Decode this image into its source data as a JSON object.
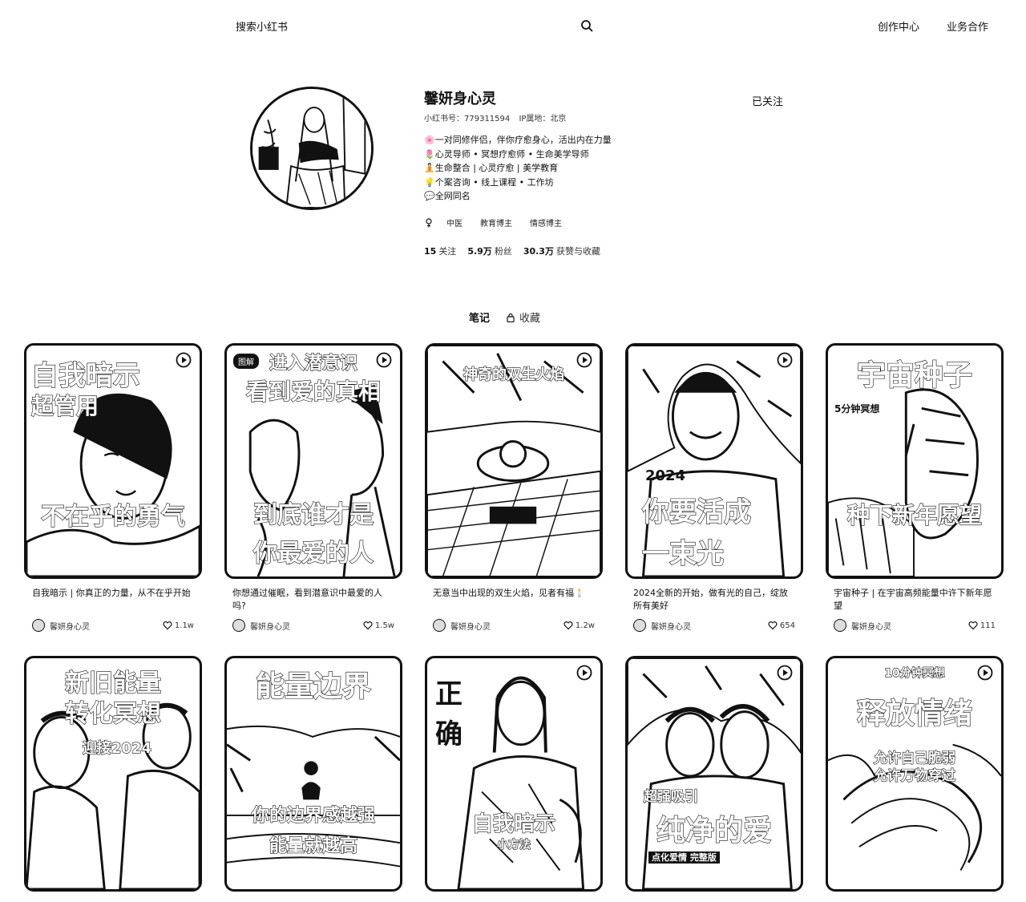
{
  "header": {
    "search_placeholder": "搜索小红书",
    "nav_create": "创作中心",
    "nav_business": "业务合作"
  },
  "profile": {
    "name": "馨妍身心灵",
    "follow_label": "已关注",
    "id_label": "小红书号：779311594",
    "ip_label": "IP属地：北京",
    "bio": [
      "🌸一对同修伴侣，伴你疗愈身心，活出内在力量",
      "🌷心灵导师 • 冥想疗愈师 • 生命美学导师",
      "🧘生命整合 | 心灵疗愈 | 美学教育",
      "💡个案咨询 • 线上课程 • 工作坊",
      "💬全网同名"
    ],
    "tags": [
      "中医",
      "教育博主",
      "情感博主"
    ],
    "stats": [
      {
        "num": "15",
        "label": "关注"
      },
      {
        "num": "5.9万",
        "label": "粉丝"
      },
      {
        "num": "30.3万",
        "label": "获赞与收藏"
      }
    ]
  },
  "tabs": {
    "notes": "笔记",
    "collect": "收藏"
  },
  "notes": [
    {
      "title": "自我暗示 | 你真正的力量，从不在乎开始",
      "author": "馨妍身心灵",
      "likes": "1.1w",
      "overlay": [
        "自我暗示",
        "超管用",
        "不在乎的勇气"
      ]
    },
    {
      "title": "你想通过催眠，看到潜意识中最爱的人吗?",
      "author": "馨妍身心灵",
      "likes": "1.5w",
      "badge": "图解",
      "overlay": [
        "进入潜意识",
        "看到爱的真相",
        "到底谁才是",
        "你最爱的人"
      ]
    },
    {
      "title": "无意当中出现的双生火焰，见者有福🕯️",
      "author": "馨妍身心灵",
      "likes": "1.2w",
      "overlay": [
        "神奇的双生火焰"
      ]
    },
    {
      "title": "2024全新的开始，做有光的自己，绽放所有美好",
      "author": "馨妍身心灵",
      "likes": "654",
      "overlay": [
        "2024",
        "你要活成",
        "一束光"
      ]
    },
    {
      "title": "宇宙种子 | 在宇宙高频能量中许下新年愿望",
      "author": "馨妍身心灵",
      "likes": "111",
      "overlay": [
        "宇宙种子",
        "5分钟冥想",
        "种下新年愿望"
      ]
    },
    {
      "title": "",
      "author": "",
      "likes": "",
      "overlay": [
        "新旧能量",
        "转化冥想",
        "迎接2024"
      ]
    },
    {
      "title": "",
      "author": "",
      "likes": "",
      "overlay": [
        "能量边界",
        "你的边界感越强",
        "能量就越高"
      ]
    },
    {
      "title": "",
      "author": "",
      "likes": "",
      "overlay": [
        "正确",
        "自我暗示",
        "小方法"
      ]
    },
    {
      "title": "",
      "author": "",
      "likes": "",
      "overlay": [
        "超强吸引",
        "纯净的爱",
        "点化爱情 完整版"
      ]
    },
    {
      "title": "",
      "author": "",
      "likes": "",
      "overlay": [
        "10分钟冥想",
        "释放情绪",
        "允许自己脆弱",
        "允许万物穿过"
      ]
    }
  ]
}
